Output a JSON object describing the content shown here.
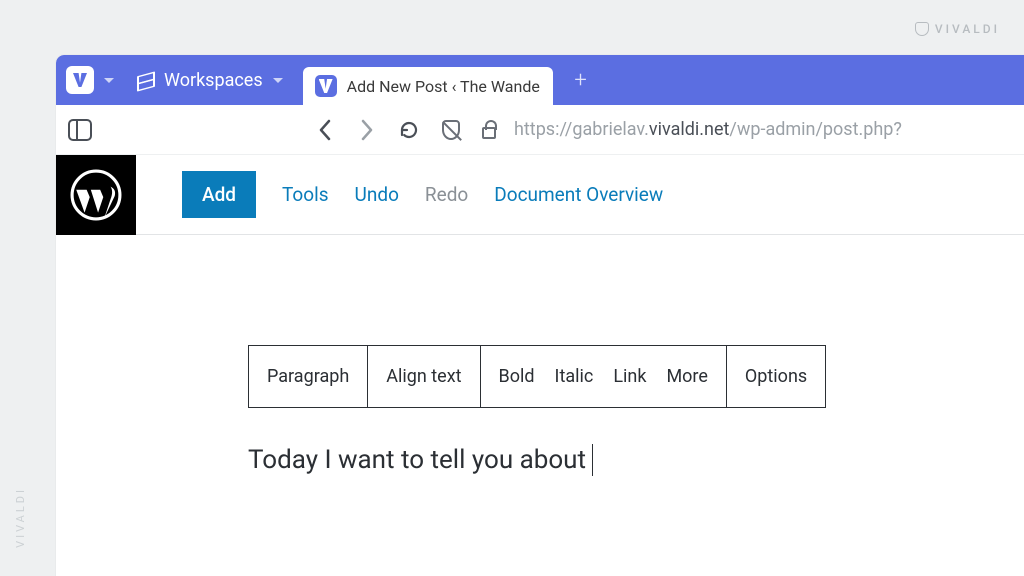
{
  "watermark": "VIVALDI",
  "browser": {
    "workspaces_label": "Workspaces",
    "tab_title": "Add New Post ‹ The Wande",
    "url_prefix": "https://gabrielav.",
    "url_host": "vivaldi.net",
    "url_suffix": "/wp-admin/post.php?"
  },
  "wp": {
    "toolbar": {
      "add": "Add",
      "tools": "Tools",
      "undo": "Undo",
      "redo": "Redo",
      "doc_overview": "Document Overview"
    },
    "block_toolbar": {
      "paragraph": "Paragraph",
      "align": "Align text",
      "bold": "Bold",
      "italic": "Italic",
      "link": "Link",
      "more": "More",
      "options": "Options"
    },
    "content": "Today I want to tell you about"
  }
}
